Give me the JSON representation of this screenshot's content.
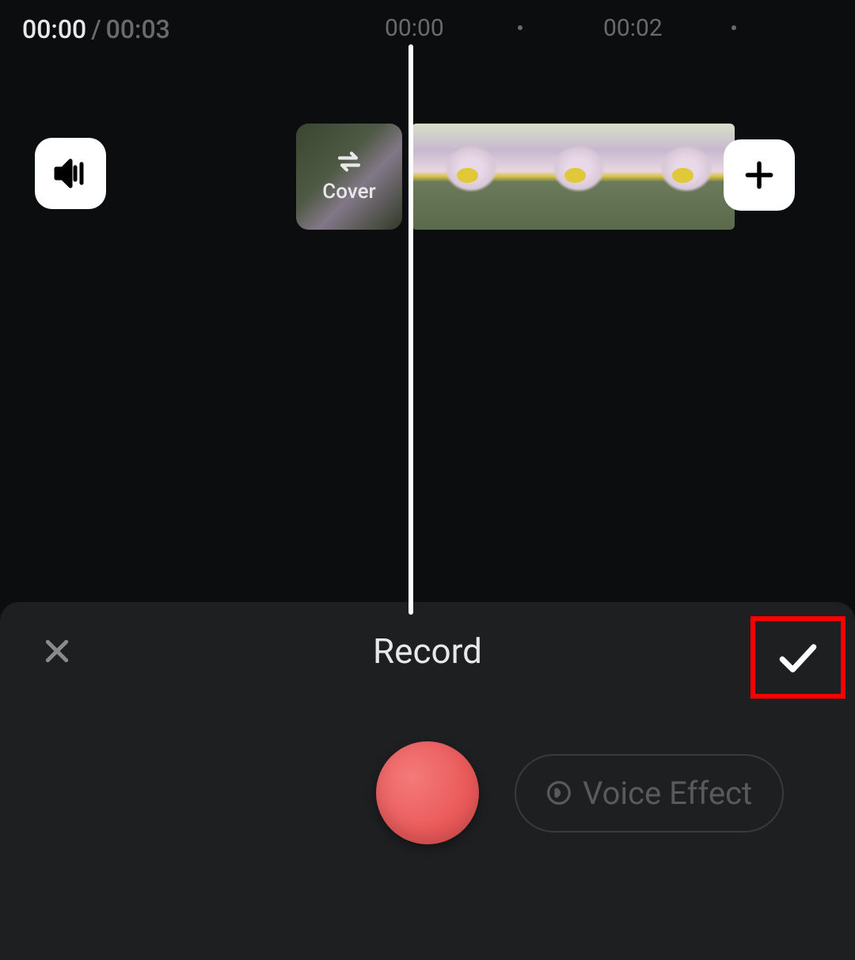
{
  "timeline": {
    "current_time": "00:00",
    "separator": "/",
    "total_time": "00:03",
    "ruler_marks": [
      "00:00",
      "00:02"
    ]
  },
  "cover": {
    "label": "Cover"
  },
  "panel": {
    "title": "Record",
    "voice_effect_label": "Voice Effect"
  }
}
